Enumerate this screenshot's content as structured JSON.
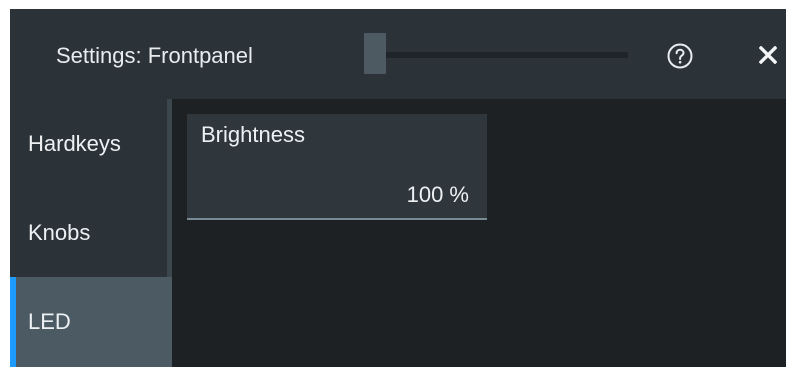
{
  "window": {
    "title": "Settings: Frontpanel",
    "help_icon": "help-circle-icon",
    "close_icon": "close-icon",
    "opacity_slider": {
      "value_fraction": 0.0
    }
  },
  "sidebar": {
    "items": [
      {
        "label": "Hardkeys",
        "selected": false
      },
      {
        "label": "Knobs",
        "selected": false
      },
      {
        "label": "LED",
        "selected": true
      }
    ]
  },
  "main": {
    "brightness": {
      "label": "Brightness",
      "value": "100 %"
    }
  },
  "colors": {
    "accent": "#1e9bff",
    "background": "#1d2124",
    "panel": "#2c3338",
    "selected_item": "#4b5a63"
  }
}
